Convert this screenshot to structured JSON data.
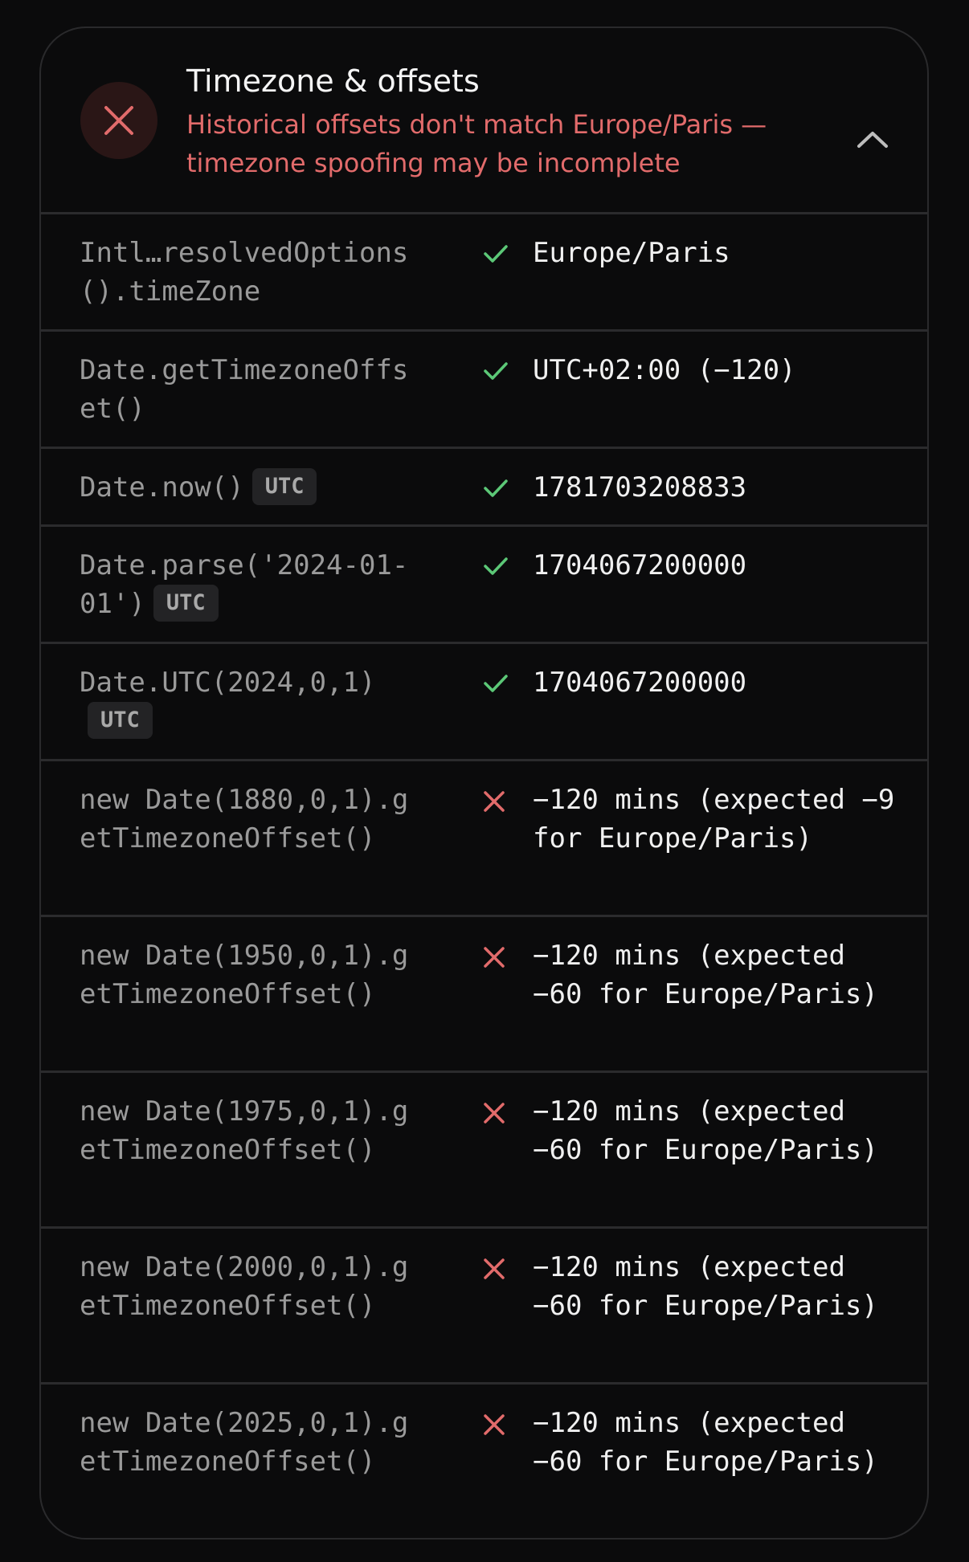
{
  "header": {
    "title": "Timezone & offsets",
    "subtitle": "Historical offsets don't match Europe/Paris — timezone spoofing may be incomplete",
    "status_icon": "close-icon",
    "collapse_icon": "chevron-up-icon"
  },
  "colors": {
    "pass": "#5cc877",
    "fail": "#e26b6b"
  },
  "rows": [
    {
      "key": "Intl…resolvedOptions().timeZone",
      "badge": null,
      "status": "pass",
      "value": "Europe/Paris"
    },
    {
      "key": "Date.getTimezoneOffset()",
      "badge": null,
      "status": "pass",
      "value": "UTC+02:00 (−120)"
    },
    {
      "key": "Date.now()",
      "badge": "UTC",
      "status": "pass",
      "value": "1781703208833"
    },
    {
      "key": "Date.parse('2024-01-01')",
      "badge": "UTC",
      "status": "pass",
      "value": "1704067200000"
    },
    {
      "key": "Date.UTC(2024,0,1)",
      "badge": "UTC",
      "status": "pass",
      "value": "1704067200000"
    },
    {
      "key": "new Date(1880,0,1).getTimezoneOffset()",
      "badge": null,
      "status": "fail",
      "value": "−120 mins (expected −9 for Europe/Paris)"
    },
    {
      "key": "new Date(1950,0,1).getTimezoneOffset()",
      "badge": null,
      "status": "fail",
      "value": "−120 mins (expected −60 for Europe/Paris)"
    },
    {
      "key": "new Date(1975,0,1).getTimezoneOffset()",
      "badge": null,
      "status": "fail",
      "value": "−120 mins (expected −60 for Europe/Paris)"
    },
    {
      "key": "new Date(2000,0,1).getTimezoneOffset()",
      "badge": null,
      "status": "fail",
      "value": "−120 mins (expected −60 for Europe/Paris)"
    },
    {
      "key": "new Date(2025,0,1).getTimezoneOffset()",
      "badge": null,
      "status": "fail",
      "value": "−120 mins (expected −60 for Europe/Paris)"
    }
  ]
}
